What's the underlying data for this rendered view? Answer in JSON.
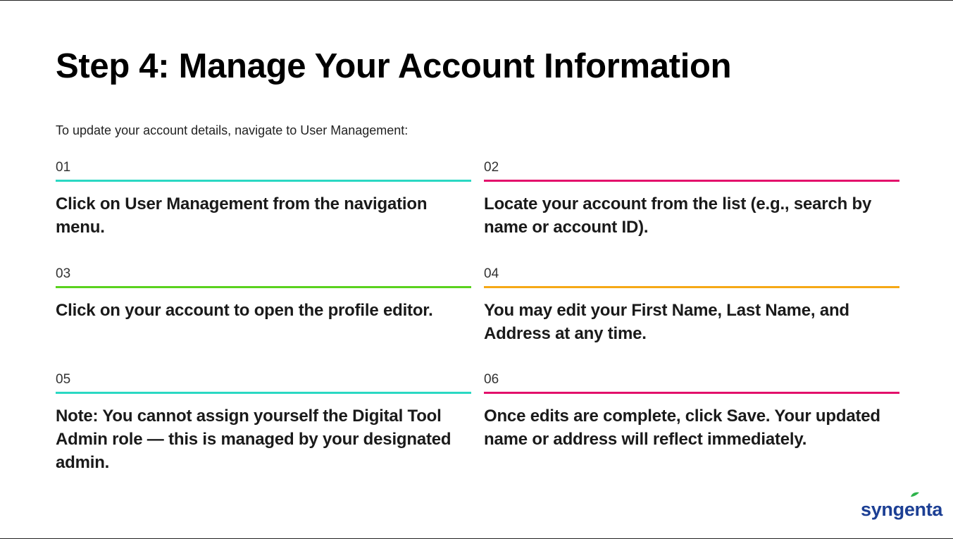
{
  "title": "Step 4: Manage Your Account Information",
  "intro": "To update your account details, navigate to User Management:",
  "steps": [
    {
      "num": "01",
      "text": "Click on User Management from the navigation menu.",
      "color": "#2ad8c3"
    },
    {
      "num": "02",
      "text": "Locate your account from the list (e.g., search by name or account ID).",
      "color": "#e3106b"
    },
    {
      "num": "03",
      "text": "Click on your account to open the profile editor.",
      "color": "#5ad21e"
    },
    {
      "num": "04",
      "text": "You may edit your First Name, Last Name, and Address at any time.",
      "color": "#f5a816"
    },
    {
      "num": "05",
      "text": "Note: You cannot assign yourself the Digital Tool Admin role — this is managed by your designated admin.",
      "color": "#2ad8c3"
    },
    {
      "num": "06",
      "text": "Once edits are complete, click Save. Your updated name or address will reflect immediately.",
      "color": "#e3106b"
    }
  ],
  "logo": {
    "text": "syngenta",
    "color": "#1c3f94",
    "leaf_color": "#2cb34a"
  }
}
